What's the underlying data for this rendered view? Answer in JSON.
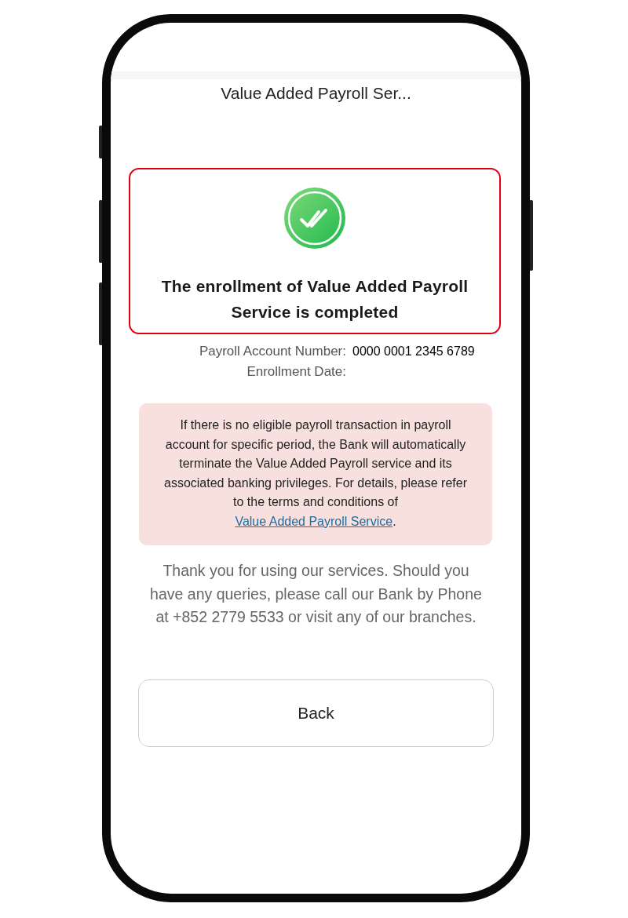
{
  "header": {
    "title": "Value Added Payroll Ser..."
  },
  "result": {
    "message": "The enrollment of Value Added Payroll Service is completed"
  },
  "details": [
    {
      "label": "Payroll Account Number:",
      "value": "0000 0001 2345 6789"
    },
    {
      "label": "Enrollment Date:"
    }
  ],
  "notice": {
    "text": "If there is no eligible payroll transaction in payroll account for specific period, the Bank will automatically terminate the Value Added Payroll service and its associated banking privileges. For details, please refer to the terms and conditions of",
    "link": "Value Added Payroll Service",
    "after_link": "."
  },
  "closing_text": "Thank you for using our services. Should you have any queries, please call our Bank by Phone at +852 2779 5533 or visit any of our branches.",
  "buttons": [
    {
      "label": "Back"
    }
  ]
}
